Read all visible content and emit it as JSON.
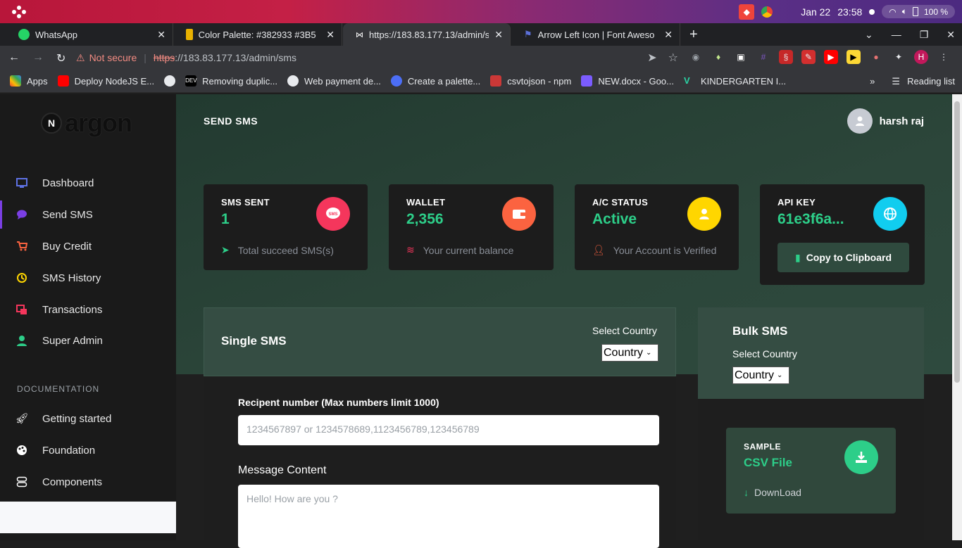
{
  "system_bar": {
    "date": "Jan 22",
    "time": "23:58",
    "battery": "100 %"
  },
  "tabs": [
    {
      "title": "WhatsApp",
      "icon": "whatsapp-icon",
      "color": "#25d366"
    },
    {
      "title": "Color Palette: #382933 #3B5",
      "icon": "palette-icon",
      "color": "#e8b100"
    },
    {
      "title": "https://183.83.177.13/admin/s",
      "icon": "bow-icon",
      "color": "#000000"
    },
    {
      "title": "Arrow Left Icon | Font Aweso",
      "icon": "flag-icon",
      "color": "#5b6fd6"
    }
  ],
  "address_bar": {
    "security": "Not secure",
    "scheme": "https",
    "url_rest": "://183.83.177.13/admin/sms"
  },
  "bookmarks": [
    {
      "label": "Apps",
      "icon": "apps-icon",
      "color": "#ea4335"
    },
    {
      "label": "Deploy NodeJS E...",
      "icon": "youtube-icon",
      "color": "#ff0000"
    },
    {
      "label": "",
      "icon": "globe-icon",
      "color": "#e8eaed"
    },
    {
      "label": "Removing duplic...",
      "icon": "dev-icon",
      "color": "#000000"
    },
    {
      "label": "Web payment de...",
      "icon": "globe-icon",
      "color": "#e8eaed"
    },
    {
      "label": "Create a palette...",
      "icon": "c-icon",
      "color": "#4c6ef5"
    },
    {
      "label": "csvtojson - npm",
      "icon": "npm-icon",
      "color": "#cb3837"
    },
    {
      "label": "NEW.docx - Goo...",
      "icon": "docs-icon",
      "color": "#7b5cff"
    },
    {
      "label": "KINDERGARTEN I...",
      "icon": "v-icon",
      "color": "#2bd4a5"
    }
  ],
  "reading_list": "Reading list",
  "sidebar": {
    "brand": "argon",
    "brand_mark": "N",
    "items": [
      {
        "label": "Dashboard",
        "icon": "monitor-icon",
        "color": "#5e72e4"
      },
      {
        "label": "Send SMS",
        "icon": "chat-icon",
        "color": "#7b3fe4"
      },
      {
        "label": "Buy Credit",
        "icon": "cart-icon",
        "color": "#fb6340"
      },
      {
        "label": "SMS History",
        "icon": "history-icon",
        "color": "#ffd600"
      },
      {
        "label": "Transactions",
        "icon": "transactions-icon",
        "color": "#f5365c"
      },
      {
        "label": "Super Admin",
        "icon": "user-icon",
        "color": "#2dce89"
      }
    ],
    "doc_heading": "DOCUMENTATION",
    "doc_items": [
      {
        "label": "Getting started",
        "icon": "rocket-icon"
      },
      {
        "label": "Foundation",
        "icon": "palette-icon"
      },
      {
        "label": "Components",
        "icon": "components-icon"
      }
    ]
  },
  "header": {
    "title": "SEND SMS",
    "user_name": "harsh raj"
  },
  "cards": [
    {
      "title": "SMS SENT",
      "value": "1",
      "sub": "Total succeed SMS(s)",
      "icon": "sms-icon",
      "color": "#f5365c",
      "sub_icon": "send-icon",
      "sub_color": "#2dce89"
    },
    {
      "title": "WALLET",
      "value": "2,356",
      "sub": "Your current balance",
      "icon": "wallet-icon",
      "color": "#fb6340",
      "sub_icon": "coins-icon",
      "sub_color": "#f5365c"
    },
    {
      "title": "A/C STATUS",
      "value": "Active",
      "sub": "Your Account is Verified",
      "icon": "user-icon",
      "color": "#ffd600",
      "sub_icon": "user-check-icon",
      "sub_color": "#fb6340"
    },
    {
      "title": "API KEY",
      "value": "61e3f6a...",
      "button": "Copy to Clipboard",
      "icon": "globe-icon",
      "color": "#11cdef"
    }
  ],
  "single_sms": {
    "title": "Single SMS",
    "select_label": "Select Country",
    "select_value": "Country",
    "recipient_label": "Recipent number (Max numbers limit 1000)",
    "recipient_placeholder": "1234567897 or 1234578689,1123456789,123456789",
    "message_label": "Message Content",
    "message_placeholder": "Hello! How are you ?"
  },
  "bulk_sms": {
    "title": "Bulk SMS",
    "select_label": "Select Country",
    "select_value": "Country",
    "sample_title": "SAMPLE",
    "sample_value": "CSV File",
    "download_label": "DownLoad"
  }
}
